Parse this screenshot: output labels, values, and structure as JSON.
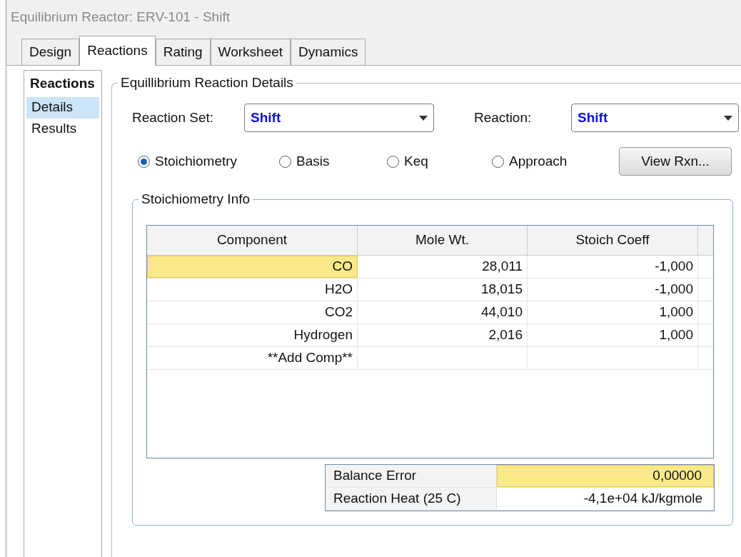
{
  "window": {
    "title": "Equilibrium Reactor: ERV-101 - Shift"
  },
  "tabs": [
    {
      "label": "Design",
      "selected": false
    },
    {
      "label": "Reactions",
      "selected": true
    },
    {
      "label": "Rating",
      "selected": false
    },
    {
      "label": "Worksheet",
      "selected": false
    },
    {
      "label": "Dynamics",
      "selected": false
    }
  ],
  "sidebar": {
    "title": "Reactions",
    "items": [
      {
        "label": "Details",
        "selected": true
      },
      {
        "label": "Results",
        "selected": false
      }
    ]
  },
  "details": {
    "title": "Equillibrium Reaction Details",
    "reaction_set": {
      "label": "Reaction Set:",
      "value": "Shift"
    },
    "reaction": {
      "label": "Reaction:",
      "value": "Shift"
    },
    "options": [
      {
        "label": "Stoichiometry",
        "selected": true
      },
      {
        "label": "Basis",
        "selected": false
      },
      {
        "label": "Keq",
        "selected": false
      },
      {
        "label": "Approach",
        "selected": false
      }
    ],
    "view_button": "View Rxn...",
    "stoichiometry": {
      "title": "Stoichiometry Info",
      "columns": [
        "Component",
        "Mole Wt.",
        "Stoich Coeff"
      ],
      "rows": [
        {
          "cells": [
            "CO",
            "28,011",
            "-1,000"
          ],
          "highlighted": true
        },
        {
          "cells": [
            "H2O",
            "18,015",
            "-1,000"
          ],
          "highlighted": false
        },
        {
          "cells": [
            "CO2",
            "44,010",
            "1,000"
          ],
          "highlighted": false
        },
        {
          "cells": [
            "Hydrogen",
            "2,016",
            "1,000"
          ],
          "highlighted": false
        },
        {
          "cells": [
            "**Add Comp**",
            "",
            ""
          ],
          "highlighted": false
        }
      ],
      "summary": [
        {
          "label": "Balance Error",
          "value": "0,00000",
          "highlighted": true
        },
        {
          "label": "Reaction Heat (25 C)",
          "value": "-4,1e+04 kJ/kgmole",
          "highlighted": false
        }
      ]
    }
  }
}
